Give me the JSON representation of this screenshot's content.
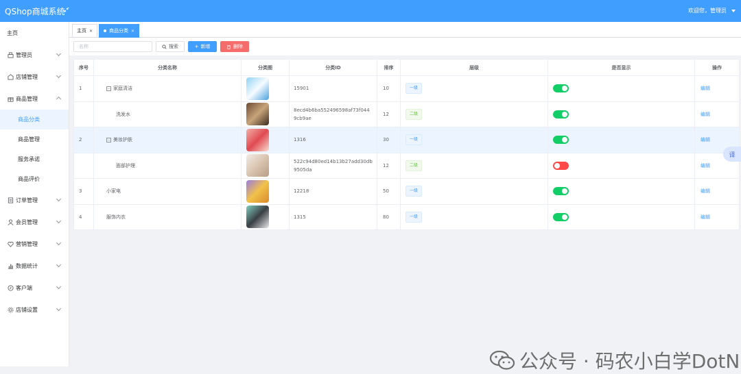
{
  "header": {
    "title": "QShop商城系统",
    "greeting": "欢迎您，管理员"
  },
  "sidebar": {
    "home": "主页",
    "items": [
      {
        "label": "管理员",
        "icon": "shop-icon"
      },
      {
        "label": "店铺管理",
        "icon": "store-icon"
      },
      {
        "label": "商品管理",
        "icon": "gift-icon",
        "open": true
      },
      {
        "label": "订单管理",
        "icon": "order-icon"
      },
      {
        "label": "会员管理",
        "icon": "user-icon"
      },
      {
        "label": "营销管理",
        "icon": "heart-icon"
      },
      {
        "label": "数据统计",
        "icon": "chart-icon"
      },
      {
        "label": "客户端",
        "icon": "compass-icon"
      },
      {
        "label": "店铺设置",
        "icon": "gear-icon"
      }
    ],
    "sub_items": [
      "商品分类",
      "商品管理",
      "服务承诺",
      "商品评价"
    ],
    "active_sub": "商品分类"
  },
  "tabs": [
    {
      "label": "主页"
    },
    {
      "label": "商品分类"
    }
  ],
  "toolbar": {
    "search_placeholder": "名称",
    "search_label": "搜索",
    "add_label": "新增",
    "delete_label": "删除"
  },
  "table": {
    "columns": [
      "序号",
      "分类名称",
      "分类图",
      "分类ID",
      "排序",
      "层级",
      "是否显示",
      "操作"
    ],
    "rows": [
      {
        "idx": "1",
        "name": "家庭清洁",
        "expand": "−",
        "id": "15901",
        "sort": "10",
        "level": "一级",
        "show": true,
        "op": "编辑",
        "child": false
      },
      {
        "idx": "",
        "name": "洗发水",
        "expand": "",
        "id": "8ecd4b6ba552496598af73f0449cb9ae",
        "sort": "12",
        "level": "二级",
        "show": true,
        "op": "编辑",
        "child": true
      },
      {
        "idx": "2",
        "name": "美妆护肤",
        "expand": "−",
        "id": "1316",
        "sort": "30",
        "level": "一级",
        "show": true,
        "op": "编辑",
        "child": false
      },
      {
        "idx": "",
        "name": "面部护理",
        "expand": "",
        "id": "522c94d80ed14b13b27add30db9505da",
        "sort": "12",
        "level": "二级",
        "show": false,
        "op": "编辑",
        "child": true
      },
      {
        "idx": "3",
        "name": "小家电",
        "expand": "",
        "id": "12218",
        "sort": "50",
        "level": "一级",
        "show": true,
        "op": "编辑",
        "child": false
      },
      {
        "idx": "4",
        "name": "服饰内衣",
        "expand": "",
        "id": "1315",
        "sort": "80",
        "level": "一级",
        "show": true,
        "op": "编辑",
        "child": false
      }
    ]
  },
  "side_widget": {
    "label": "译"
  },
  "watermark": {
    "text": "公众号 · 码农小白学DotNet"
  },
  "colors": {
    "primary": "#409eff",
    "danger": "#f56c6c",
    "switch_on": "#13ce66",
    "switch_off": "#ff4949"
  }
}
